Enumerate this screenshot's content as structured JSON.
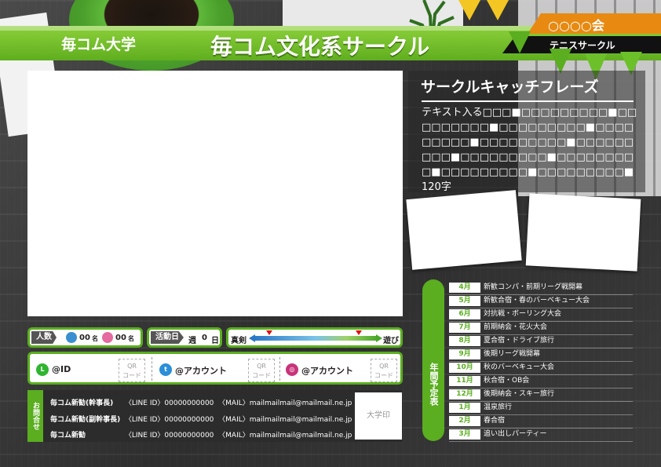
{
  "header": {
    "university": "毎コム大学",
    "title": "毎コム文化系サークル",
    "org": "○○○○会",
    "category": "テニスサークル"
  },
  "catch": {
    "title": "サークルキャッチフレーズ",
    "text": "テキスト入る□□□■□□□□□□□□□■□□□□□□□□□■□□□□□□□□□■□□□□□□□□□■□□□□□□□□□■□□□□□□□□□■□□□□□□□□□■□□□□□□□□□■□□□□□□□□□■□□□□□□□□□■120字"
  },
  "members": {
    "label": "人数",
    "male_count": "00",
    "male_unit": "名",
    "female_count": "00",
    "female_unit": "名"
  },
  "activity": {
    "label": "活動日",
    "prefix": "週",
    "days": "0",
    "unit": "日"
  },
  "scale": {
    "left": "真剣",
    "right": "遊び"
  },
  "sns": [
    {
      "label": "@ID",
      "qr1": "QR",
      "qr2": "コード",
      "icon": "line-icon",
      "color": "#2fb52f"
    },
    {
      "label": "@アカウント",
      "qr1": "QR",
      "qr2": "コード",
      "icon": "twitter-icon",
      "color": "#2a8fd8"
    },
    {
      "label": "@アカウント",
      "qr1": "QR",
      "qr2": "コード",
      "icon": "instagram-icon",
      "color": "#c8347a"
    }
  ],
  "contact": {
    "tab": "お問合せ",
    "seal": "大学印",
    "rows": [
      {
        "name": "毎コム新勧(幹事長)",
        "line": "〈LINE ID〉00000000000",
        "mail": "〈MAIL〉mailmailmail@mailmail.ne.jp"
      },
      {
        "name": "毎コム新勧(副幹事長)",
        "line": "〈LINE ID〉00000000000",
        "mail": "〈MAIL〉mailmailmail@mailmail.ne.jp"
      },
      {
        "name": "毎コム新勧",
        "line": "〈LINE ID〉00000000000",
        "mail": "〈MAIL〉mailmailmail@mailmail.ne.jp"
      }
    ]
  },
  "schedule": {
    "tab": "年間予定表",
    "items": [
      {
        "month": "4月",
        "event": "新歓コンパ・前期リーグ戦開幕"
      },
      {
        "month": "5月",
        "event": "新歓合宿・春のバーベキュー大会"
      },
      {
        "month": "6月",
        "event": "対抗戦・ボーリング大会"
      },
      {
        "month": "7月",
        "event": "前期納会・花火大会"
      },
      {
        "month": "8月",
        "event": "夏合宿・ドライブ旅行"
      },
      {
        "month": "9月",
        "event": "後期リーグ戦開幕"
      },
      {
        "month": "10月",
        "event": "秋のバーベキュー大会"
      },
      {
        "month": "11月",
        "event": "秋合宿・OB会"
      },
      {
        "month": "12月",
        "event": "後期納会・スキー旅行"
      },
      {
        "month": "1月",
        "event": "温泉旅行"
      },
      {
        "month": "2月",
        "event": "春合宿"
      },
      {
        "month": "3月",
        "event": "追い出しパーティー"
      }
    ]
  }
}
